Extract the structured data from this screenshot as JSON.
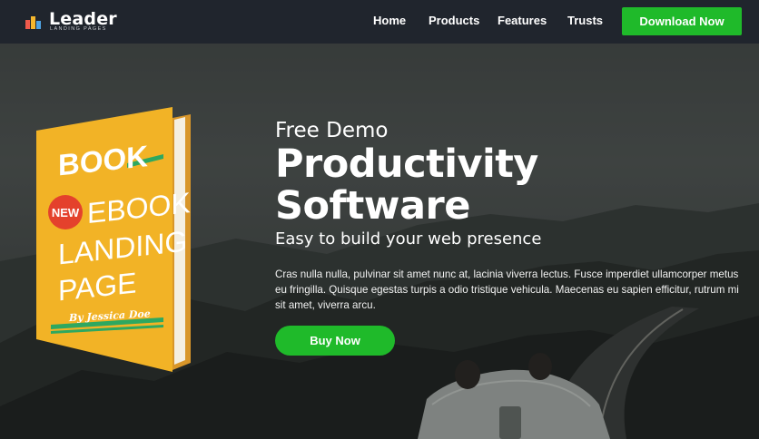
{
  "nav": {
    "logo_text": "Leader",
    "logo_sub": "LANDING PAGES",
    "links": [
      "Home",
      "Products",
      "Features",
      "Trusts"
    ],
    "cta": "Download Now"
  },
  "book": {
    "word1": "BOOK",
    "badge": "NEW",
    "word2": "EBOOK",
    "word3": "LANDING",
    "word4": "PAGE",
    "author": "By Jessica Doe"
  },
  "hero": {
    "eyebrow": "Free Demo",
    "title_line1": "Productivity",
    "title_line2": "Software",
    "subtitle": "Easy to build your web presence",
    "paragraph": "Cras nulla nulla, pulvinar sit amet nunc at, lacinia viverra lectus. Fusce imperdiet ullamcorper metus eu fringilla. Quisque egestas turpis a odio tristique vehicula. Maecenas eu sapien efficitur, rutrum mi sit amet, viverra arcu.",
    "cta": "Buy Now"
  },
  "colors": {
    "nav_bg": "#20252d",
    "accent_green": "#1fba2a",
    "book_yellow": "#f2b326",
    "badge_red": "#e4412c",
    "stripe_green": "#2ea860"
  }
}
